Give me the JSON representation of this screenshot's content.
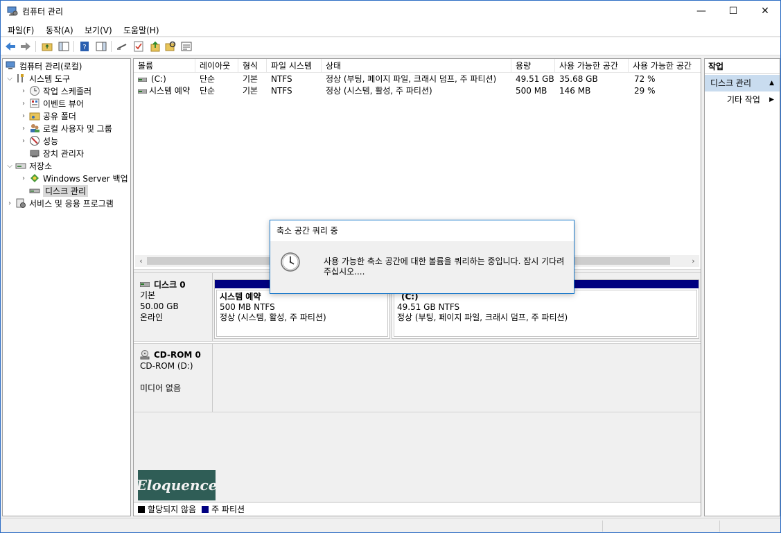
{
  "window": {
    "title": "컴퓨터 관리"
  },
  "window_controls": {
    "minimize": "—",
    "maximize": "☐",
    "close": "✕"
  },
  "menu": [
    "파일(F)",
    "동작(A)",
    "보기(V)",
    "도움말(H)"
  ],
  "tree": {
    "root": "컴퓨터 관리(로컬)",
    "system_tools": "시스템 도구",
    "task_scheduler": "작업 스케줄러",
    "event_viewer": "이벤트 뷰어",
    "shared_folders": "공유 폴더",
    "local_users": "로컬 사용자 및 그룹",
    "performance": "성능",
    "device_manager": "장치 관리자",
    "storage": "저장소",
    "windows_backup": "Windows Server 백업",
    "disk_management": "디스크 관리",
    "services": "서비스 및 응용 프로그램"
  },
  "volume_list": {
    "columns": [
      "볼륨",
      "레이아웃",
      "형식",
      "파일 시스템",
      "상태",
      "용량",
      "사용 가능한 공간",
      "사용 가능한 공간"
    ],
    "rows": [
      {
        "volume": "(C:)",
        "layout": "단순",
        "type": "기본",
        "fs": "NTFS",
        "status": "정상 (부팅, 페이지 파일, 크래시 덤프, 주 파티션)",
        "capacity": "49.51 GB",
        "free": "35.68 GB",
        "free_pct": "72 %"
      },
      {
        "volume": "시스템 예약",
        "layout": "단순",
        "type": "기본",
        "fs": "NTFS",
        "status": "정상 (시스템, 활성, 주 파티션)",
        "capacity": "500 MB",
        "free": "146 MB",
        "free_pct": "29 %"
      }
    ]
  },
  "disks": {
    "disk0": {
      "name": "디스크 0",
      "type": "기본",
      "size": "50.00 GB",
      "state": "온라인",
      "partitions": [
        {
          "name": "시스템 예약",
          "size_fs": "500 MB NTFS",
          "status": "정상 (시스템, 활성, 주 파티션)"
        },
        {
          "name": "(C:)",
          "size_fs": "49.51 GB NTFS",
          "status": "정상 (부팅, 페이지 파일, 크래시 덤프, 주 파티션)"
        }
      ]
    },
    "cdrom0": {
      "name": "CD-ROM 0",
      "drive": "CD-ROM (D:)",
      "media": "미디어 없음"
    }
  },
  "watermark": "Eloquence",
  "legend": {
    "unallocated": "할당되지 않음",
    "primary": "주 파티션"
  },
  "actions": {
    "header": "작업",
    "section": "디스크 관리",
    "more": "기타 작업"
  },
  "dialog": {
    "title": "축소 공간 쿼리 중",
    "message": "사용 가능한 축소 공간에 대한 볼륨을 쿼리하는 중입니다. 잠시 기다려 주십시오...."
  },
  "colors": {
    "primary_partition": "#000080",
    "unallocated": "#000000",
    "selected_action": "#c9dcef",
    "window_border": "#2b6cc4"
  }
}
